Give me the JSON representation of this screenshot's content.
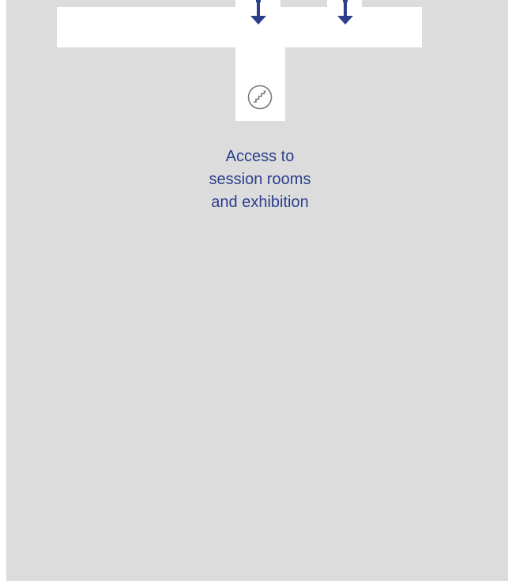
{
  "map": {
    "access_label_lines": [
      "Access to",
      "session rooms",
      "and exhibition"
    ],
    "colors": {
      "floor": "#dcdcdc",
      "corridor": "#ffffff",
      "arrow": "#2b3f8c",
      "icon_stroke": "#7a7a7a",
      "label": "#2b3f8c"
    },
    "icons": {
      "arrows": [
        "down-arrow-icon",
        "down-arrow-icon"
      ],
      "stairs": "stairs-icon"
    }
  }
}
